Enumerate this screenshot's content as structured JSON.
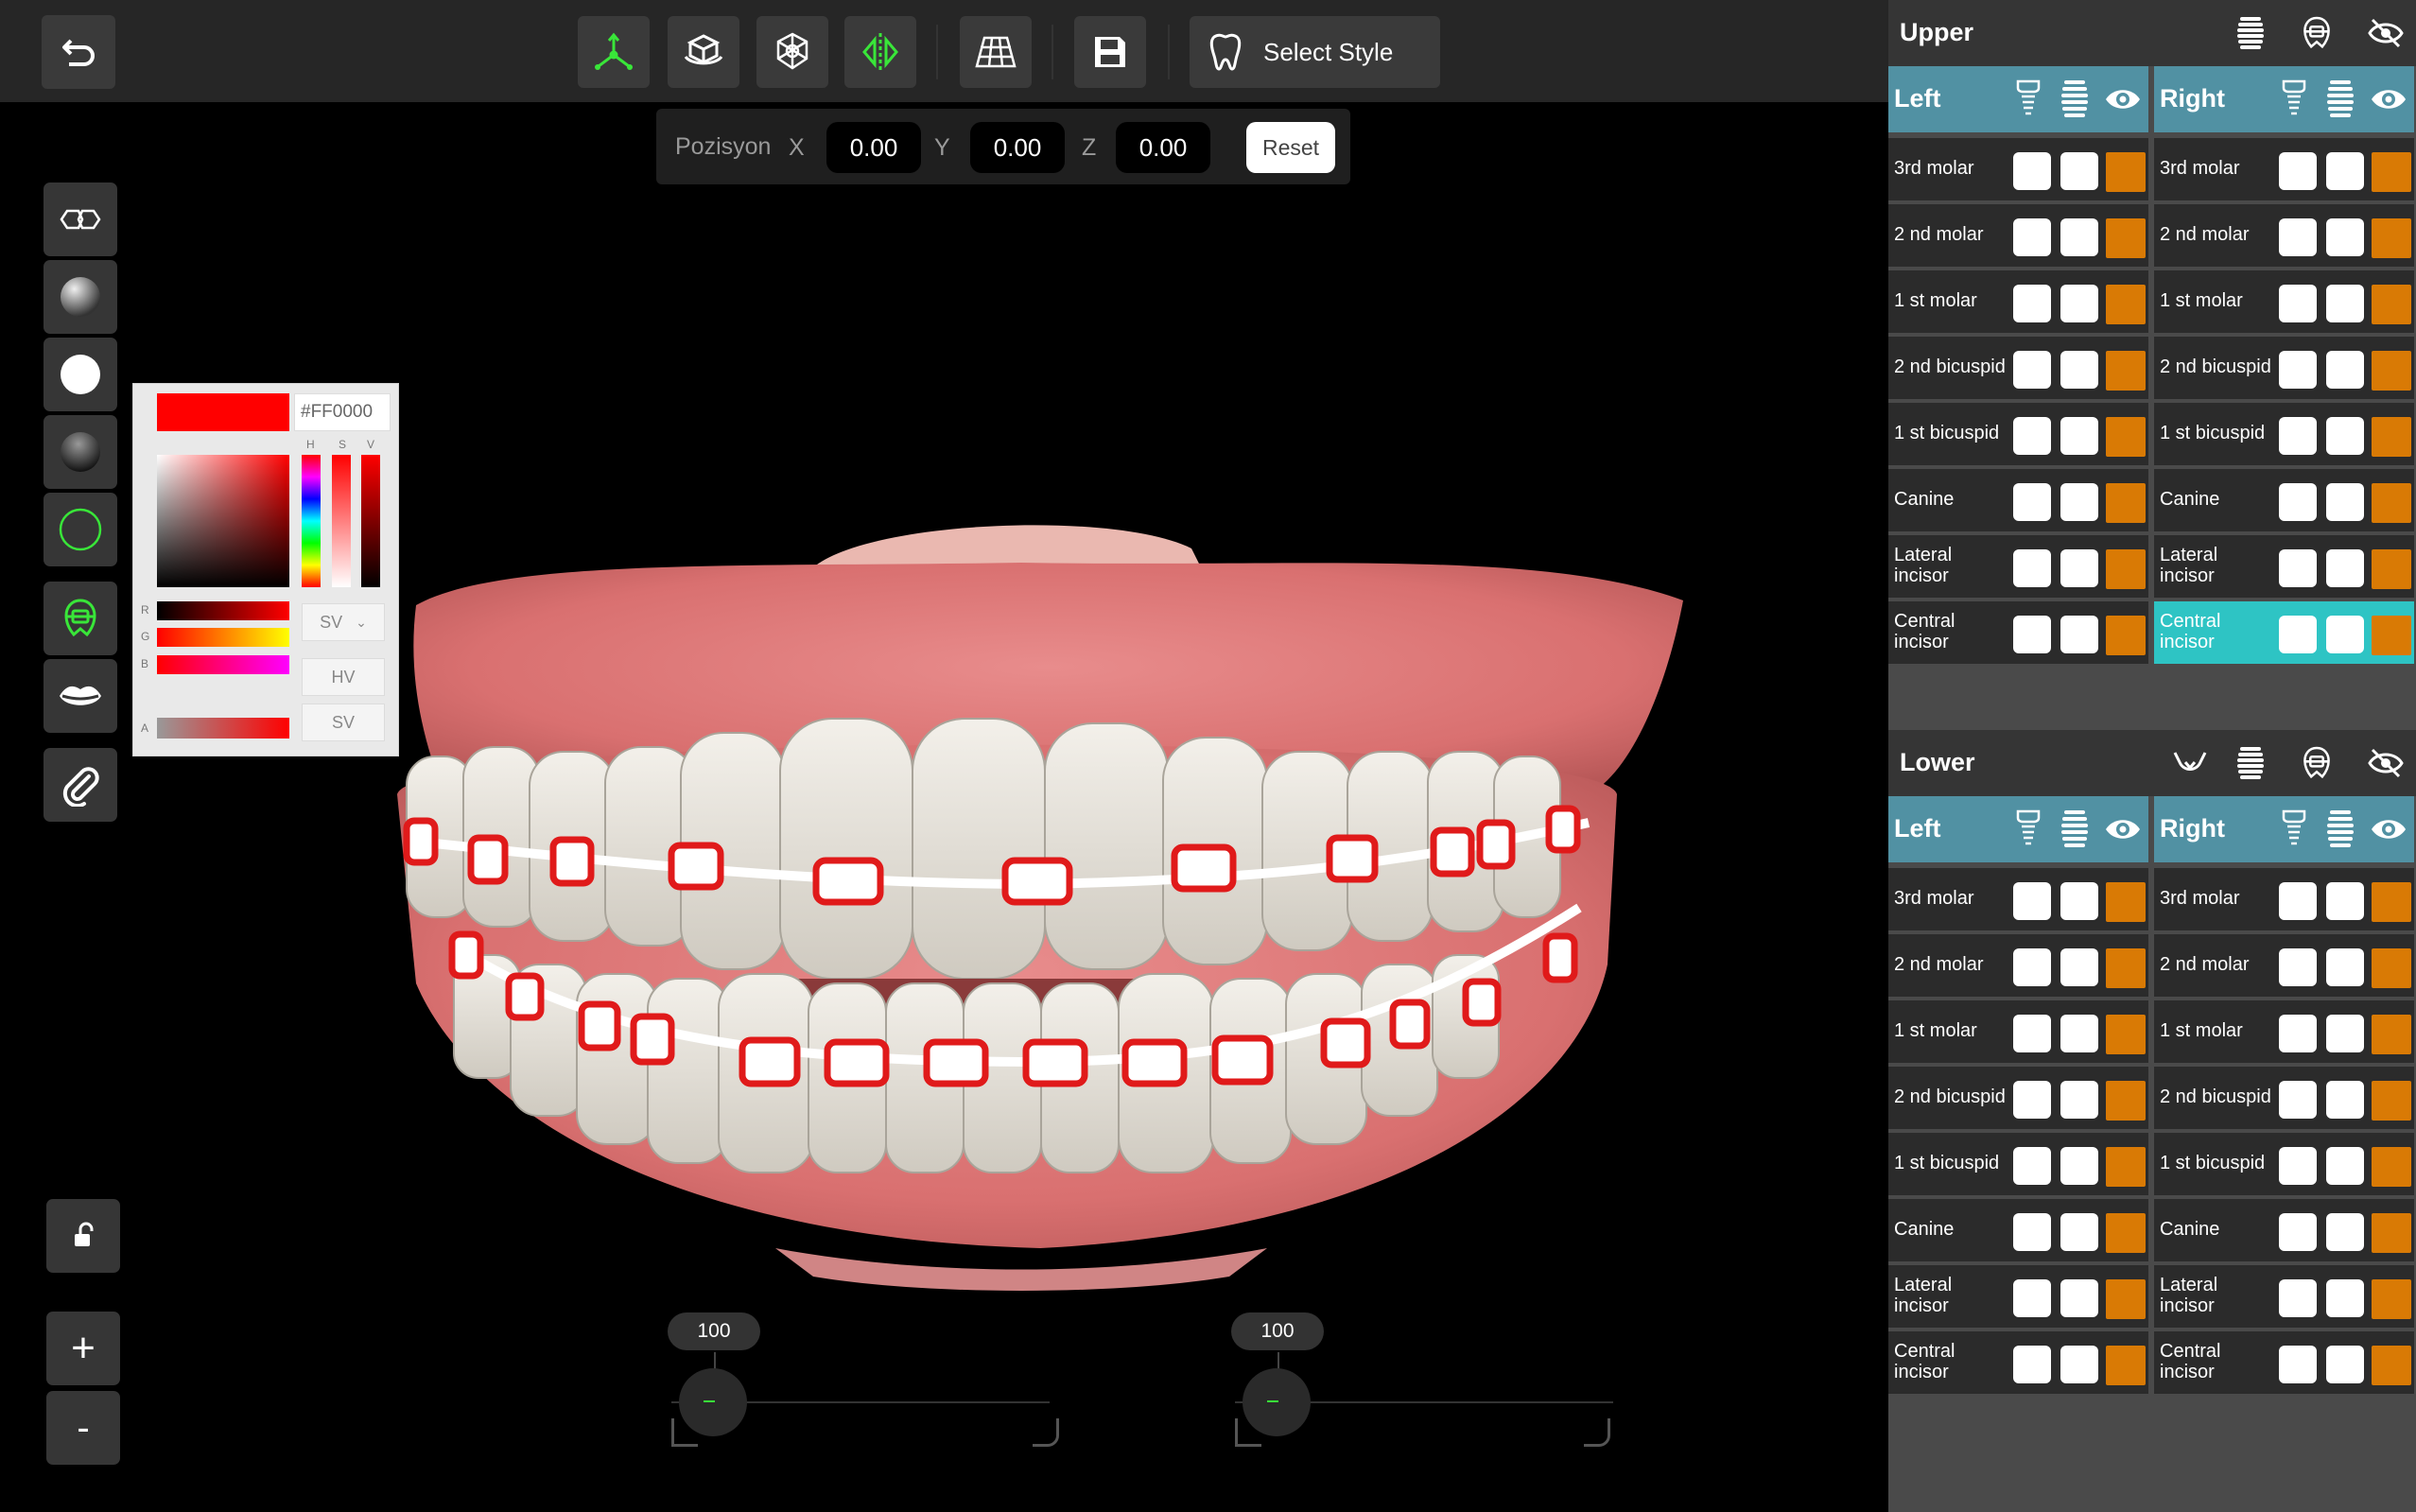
{
  "toolbar": {
    "select_style_label": "Select Style"
  },
  "position": {
    "label": "Pozisyon",
    "x_label": "X",
    "y_label": "Y",
    "z_label": "Z",
    "x": "0.00",
    "y": "0.00",
    "z": "0.00",
    "reset_label": "Reset"
  },
  "color_picker": {
    "hex": "#FF0000",
    "selected_color": "#FF0000",
    "h_label": "H",
    "s_label": "S",
    "v_label": "V",
    "r_label": "R",
    "g_label": "G",
    "b_label": "B",
    "a_label": "A",
    "mode_value": "SV",
    "hv_label": "HV",
    "sv_label": "SV"
  },
  "sliders": {
    "left_value": "100",
    "right_value": "100"
  },
  "panel": {
    "upper": {
      "title": "Upper",
      "left_title": "Left",
      "right_title": "Right"
    },
    "lower": {
      "title": "Lower",
      "left_title": "Left",
      "right_title": "Right"
    },
    "teeth": [
      "3rd molar",
      "2 nd  molar",
      "1 st molar",
      "2 nd bicuspid",
      "1 st bicuspid",
      "Canine",
      "Lateral incisor",
      "Central incisor"
    ],
    "selected": {
      "section": "upper",
      "side": "right",
      "tooth": "Central incisor"
    }
  },
  "colors": {
    "accent_green": "#39e639",
    "header_teal": "#5191a3",
    "selected_row": "#2ec4c4",
    "orange": "#d97a05",
    "bracket_red": "#e01a1a"
  },
  "icons": [
    "undo-icon",
    "axis-move-icon",
    "cube-rotate-icon",
    "mesh-icon",
    "mirror-icon",
    "grid-icon",
    "save-icon",
    "tooth-icon",
    "teeth-pair-icon",
    "sphere-matte-icon",
    "sphere-white-icon",
    "sphere-dark-icon",
    "outline-circle-icon",
    "brace-icon",
    "lips-icon",
    "paperclip-icon",
    "unlock-icon",
    "implant-icon",
    "brace-stack-icon",
    "eye-icon",
    "eye-slash-icon",
    "lower-jaw-icon"
  ]
}
